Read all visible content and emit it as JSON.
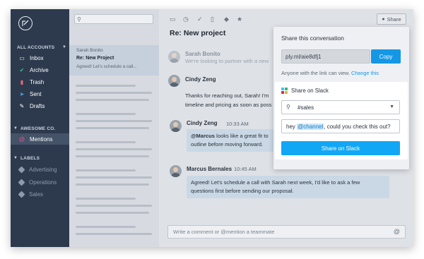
{
  "sidebar": {
    "sections": {
      "all_accounts": "ALL ACCOUNTS",
      "awesome_co": "AWESOME CO.",
      "labels": "LABELS"
    },
    "items": [
      {
        "label": "Inbox",
        "icon": "inbox-icon"
      },
      {
        "label": "Archive",
        "icon": "check-icon"
      },
      {
        "label": "Trash",
        "icon": "trash-icon"
      },
      {
        "label": "Sent",
        "icon": "send-icon"
      },
      {
        "label": "Drafts",
        "icon": "pencil-icon"
      }
    ],
    "team_items": [
      {
        "label": "Mentions",
        "icon": "at-icon",
        "active": true
      }
    ],
    "labels": [
      {
        "label": "Advertising"
      },
      {
        "label": "Operations"
      },
      {
        "label": "Sales"
      }
    ]
  },
  "message_list": {
    "selected": {
      "from": "Sarah Bonito",
      "subject": "Re:  New Project",
      "preview": "Agreed! Let's schedule a call..."
    }
  },
  "thread": {
    "title": "Re: New project",
    "messages": [
      {
        "sender": "Sarah Bonito",
        "time": "",
        "lines": [
          "We're looking to partner with a new"
        ]
      },
      {
        "sender": "Cindy Zeng",
        "time": "",
        "lines": [
          "Thanks for reaching out, Sarah! I'm",
          "timeline and pricing as soon as poss"
        ]
      },
      {
        "sender": "Cindy Zeng",
        "time": "10:33 AM",
        "mention": "@Marcus",
        "lines": [
          " looks like a great fit to",
          "outline before moving forward."
        ]
      },
      {
        "sender": "Marcus Bernales",
        "time": "10:45 AM",
        "lines": [
          "Agreed! Let's schedule a call with Sarah next week, I'd like to ask a few",
          "questions first before sending our proposal."
        ]
      }
    ],
    "composer_placeholder": "Write a comment or @mention a teammate"
  },
  "toolbar": {
    "share_label": "Share",
    "icons": [
      "inbox-icon",
      "clock-icon",
      "check-icon",
      "trash-icon",
      "tag-icon",
      "star-icon"
    ]
  },
  "share_popover": {
    "title": "Share this conversation",
    "link": "ply.ml/aie8dfj1",
    "copy_label": "Copy",
    "anyone_text": "Anyone with the link can view.",
    "change_link": "Change this",
    "slack": {
      "title": "Share on Slack",
      "channel": "#sales",
      "message_prefix": "hey ",
      "message_channel": "@channel",
      "message_suffix": ", could you check this out?",
      "button_label": "Share on Slack"
    }
  },
  "colors": {
    "sidebar_bg": "#2d3a4e",
    "accent_blue": "#1597e5",
    "slack_button": "#11a7f5"
  }
}
